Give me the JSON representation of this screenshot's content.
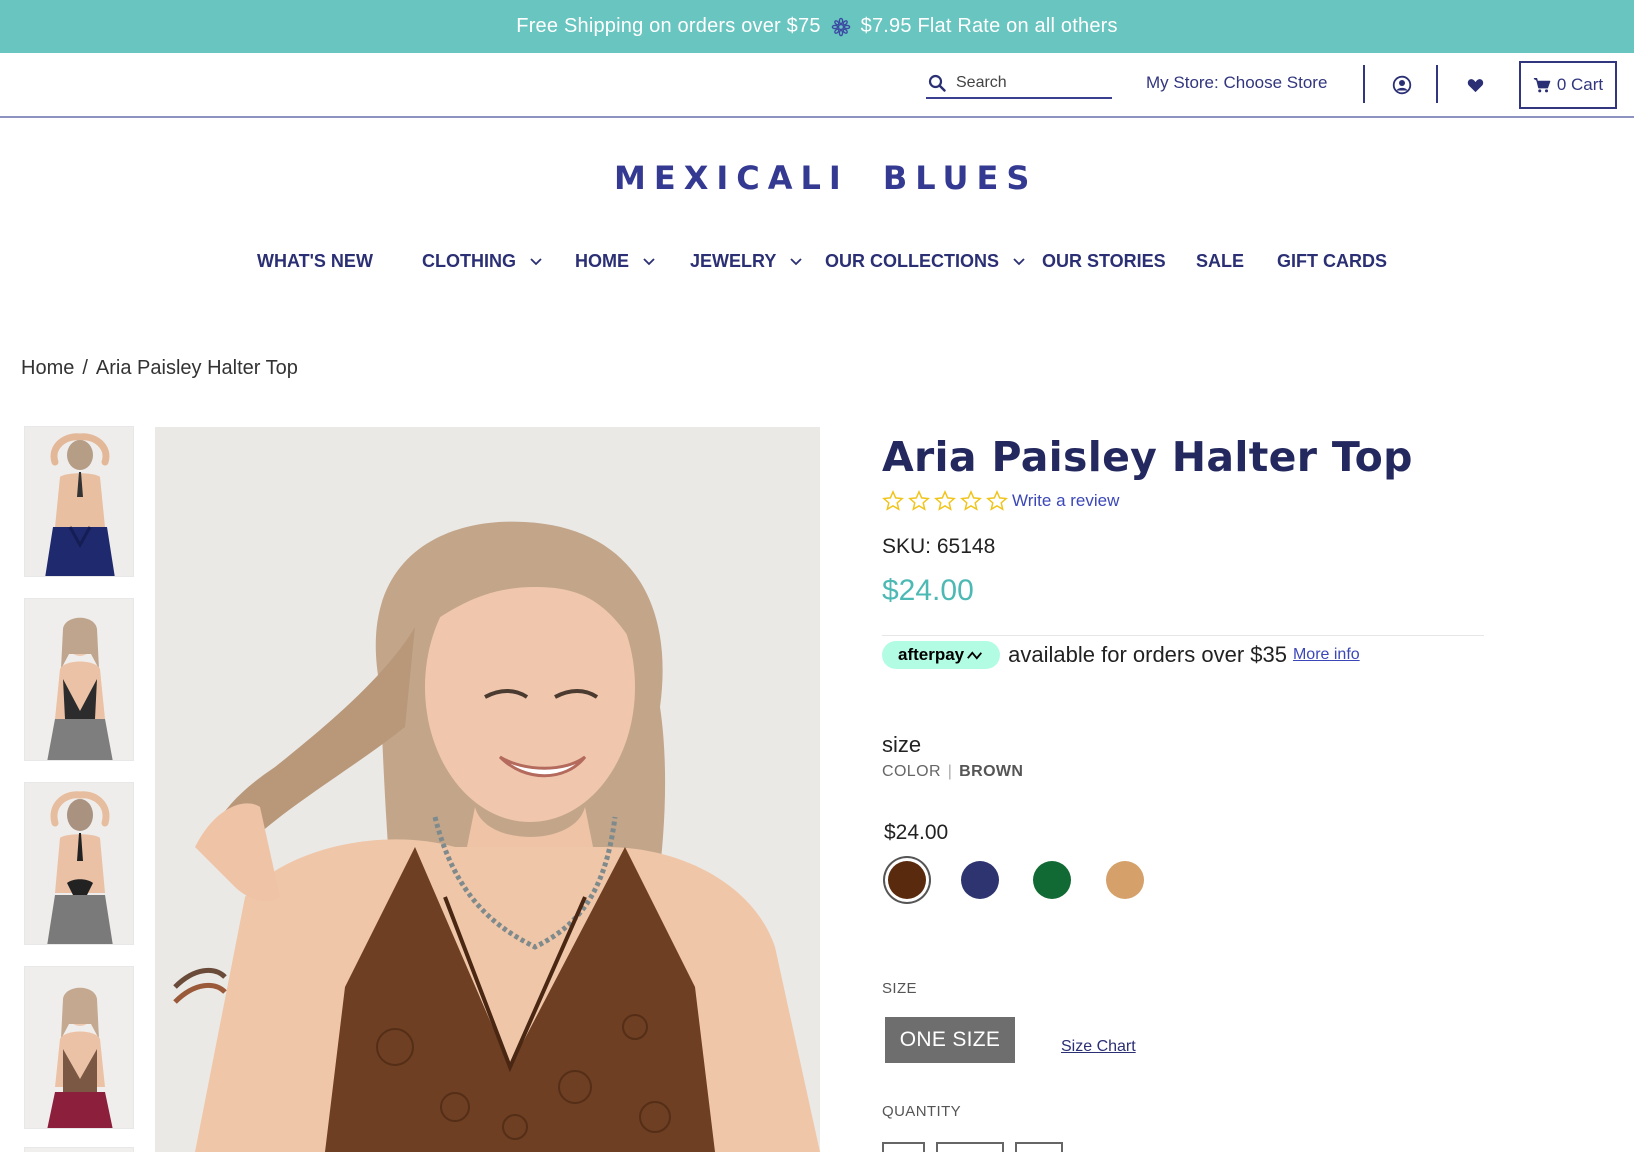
{
  "announcement": {
    "left": "Free Shipping on orders over $75",
    "right": "$7.95 Flat Rate on all others"
  },
  "utility": {
    "search_placeholder": "Search",
    "my_store": "My Store: Choose Store",
    "cart_label": "0 Cart"
  },
  "logo": {
    "left_word": "MEXICALI",
    "right_word": "BLUES"
  },
  "nav": {
    "items": [
      {
        "label": "WHAT'S NEW"
      },
      {
        "label": "CLOTHING"
      },
      {
        "label": "HOME"
      },
      {
        "label": "JEWELRY"
      },
      {
        "label": "OUR COLLECTIONS"
      },
      {
        "label": "OUR STORIES"
      },
      {
        "label": "SALE"
      },
      {
        "label": "GIFT CARDS"
      }
    ]
  },
  "breadcrumb": {
    "home": "Home",
    "separator": "/",
    "current": "Aria Paisley Halter Top"
  },
  "product": {
    "title": "Aria Paisley Halter Top",
    "rating_stars": 0,
    "write_review": "Write a review",
    "sku": "SKU: 65148",
    "price": "$24.00",
    "afterpay": {
      "badge": "afterpay",
      "text": "available for orders over $35",
      "more": "More info"
    },
    "option_label": "size",
    "color_label": "COLOR",
    "color_value": "BROWN",
    "variant_price": "$24.00",
    "swatches": [
      {
        "name": "brown",
        "color": "#5a2a0e",
        "selected": true
      },
      {
        "name": "navy",
        "color": "#2e3470"
      },
      {
        "name": "green",
        "color": "#116a33"
      },
      {
        "name": "tan",
        "color": "#d5a06a"
      }
    ],
    "size_label": "SIZE",
    "size_value": "ONE SIZE",
    "size_chart": "Size Chart",
    "quantity_label": "QUANTITY"
  },
  "colors": {
    "accent": "#69c5c0",
    "brand": "#343a92",
    "price": "#4cb9b4",
    "afterpay": "#b2fce4"
  }
}
